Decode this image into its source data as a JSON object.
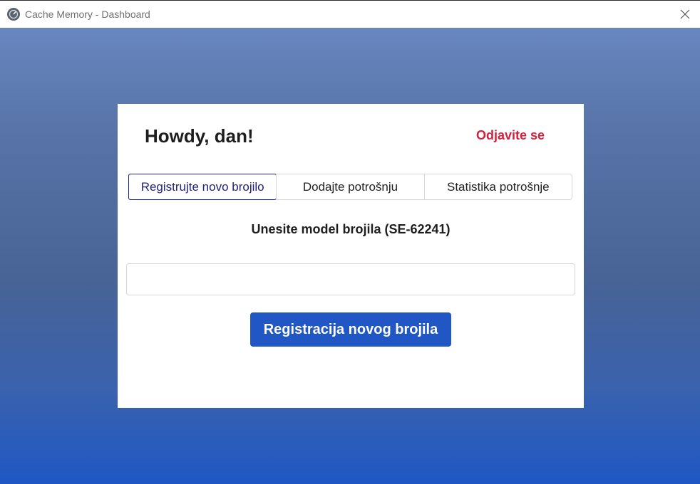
{
  "window": {
    "title": "Cache Memory - Dashboard",
    "app_icon": "speedometer-icon",
    "close_icon": "close-icon"
  },
  "header": {
    "greeting": "Howdy, dan!",
    "logout_label": "Odjavite se"
  },
  "tabs": [
    {
      "label": "Registrujte novo brojilo",
      "active": true
    },
    {
      "label": "Dodajte potrošnju",
      "active": false
    },
    {
      "label": "Statistika potrošnje",
      "active": false
    }
  ],
  "form": {
    "prompt": "Unesite model brojila (SE-62241)",
    "model_value": "",
    "submit_label": "Registracija novog brojila"
  },
  "colors": {
    "accent": "#2157c4",
    "logout": "#d0213f",
    "active_tab_border": "#22227a"
  }
}
